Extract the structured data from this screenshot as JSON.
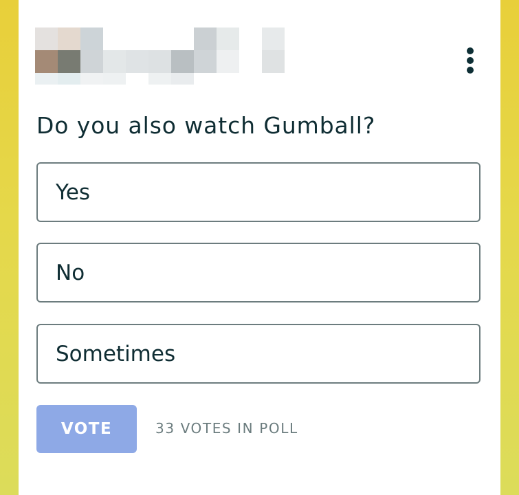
{
  "header": {
    "username_blurred": "",
    "menu_icon": "kebab-vertical-icon"
  },
  "poll": {
    "question": "Do you also watch Gumball?",
    "options": [
      {
        "label": "Yes"
      },
      {
        "label": "No"
      },
      {
        "label": "Sometimes"
      }
    ],
    "vote_button_label": "VOTE",
    "vote_count_text": "33 VOTES IN POLL"
  },
  "colors": {
    "background": "#e6d543",
    "card": "#ffffff",
    "text": "#0f2d33",
    "option_border": "#6c7c7e",
    "vote_button": "#8ea9e6",
    "muted_text": "#6b7c7e"
  }
}
